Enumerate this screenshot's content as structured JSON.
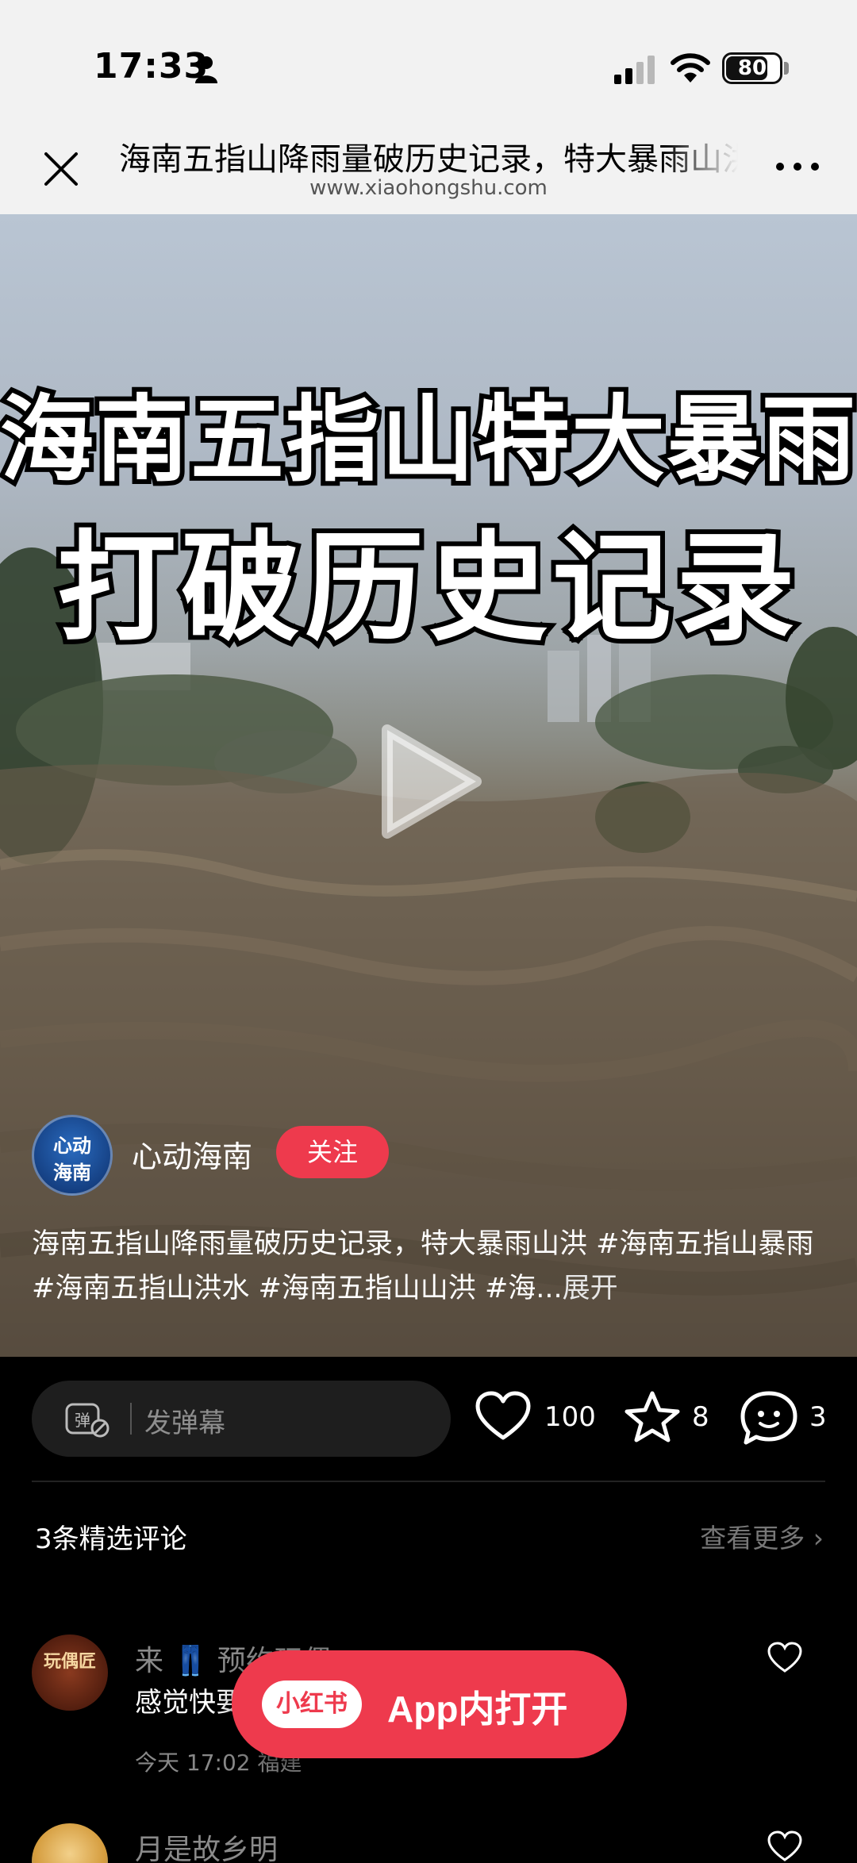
{
  "status_bar": {
    "time": "17:33",
    "battery": "80",
    "battery_level": 0.8
  },
  "browser": {
    "title": "海南五指山降雨量破历史记录，特大暴雨山洪",
    "url": "www.xiaohongshu.com",
    "close_icon": "close-icon",
    "more_icon": "more-icon"
  },
  "video": {
    "headline_line1": "海南五指山特大暴雨",
    "headline_line2": "打破历史记录",
    "play_icon": "play-icon"
  },
  "author": {
    "avatar_line1": "心动",
    "avatar_line2": "海南",
    "name": "心动海南",
    "follow_label": "关注"
  },
  "caption": {
    "text": "海南五指山降雨量破历史记录，特大暴雨山洪",
    "tags": [
      "#海南五指山暴雨",
      "#海南五指山洪水",
      "#海南五指山山洪",
      "#海..."
    ],
    "expand_label": "展开"
  },
  "interaction": {
    "danmaku_placeholder": "发弹幕",
    "likes": "100",
    "stars": "8",
    "comments": "3"
  },
  "comments": {
    "header": "3条精选评论",
    "view_more": "查看更多",
    "items": [
      {
        "avatar_text": "玩偶匠",
        "user": "来 👖 预约玩偶",
        "text": "感觉快要",
        "meta": "今天 17:02 福建"
      },
      {
        "user": "月是故乡明"
      }
    ]
  },
  "open_app": {
    "logo": "小红书",
    "label": "App内打开"
  },
  "colors": {
    "accent": "#ee3a4d",
    "background": "#000000",
    "header_bg": "#f2f2f2"
  }
}
